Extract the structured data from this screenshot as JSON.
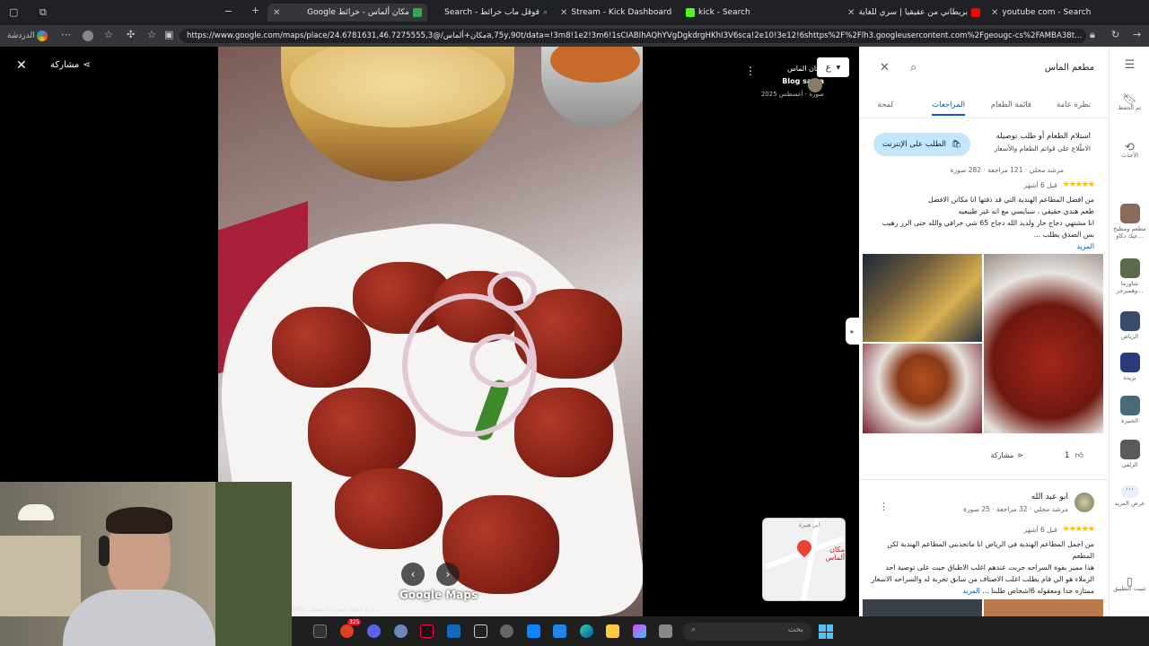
{
  "browser": {
    "tabs": [
      {
        "label": "مكان ألماس - خرائط Google",
        "active": true
      },
      {
        "label": "قوقل ماب خرائط - Search",
        "active": false
      },
      {
        "label": "Stream - Kick Dashboard",
        "active": false
      },
      {
        "label": "kick - Search",
        "active": false
      },
      {
        "label": "بريطاني من عقيقيا | سري للغاية",
        "active": false
      },
      {
        "label": "youtube com - Search",
        "active": false
      }
    ],
    "profile_label": "الدردشة",
    "url": "https://www.google.com/maps/place/مكان+ألماس/@24.6781631,46.7275555,3a,75y,90t/data=!3m8!1e2!3m6!1sCIABIhAQhYVgDgkdrgHKhI3V6sca!2e10!3e12!6shttps%2F%2Flh3.googleusercontent.com%2Fgeougc-cs%2FAMBA38t..."
  },
  "viewer": {
    "share_label": "مشاركة",
    "place_name": "مكان الماس",
    "author": "Blog sama",
    "date": "صورة - أغسطس 2025",
    "watermark": "Google Maps",
    "photo_date_caption": "تاريخ التقاط الصورة: أغسطس 2025",
    "map_label": "مكان ألماس",
    "map_street": "أبي هبيرة",
    "badge": "ع"
  },
  "panel": {
    "search_value": "مطعم الماس",
    "tabs": [
      {
        "label": "نظرة عامة",
        "selected": false
      },
      {
        "label": "قائمة الطعام",
        "selected": false
      },
      {
        "label": "المراجعات",
        "selected": true
      },
      {
        "label": "لمحة",
        "selected": false
      }
    ],
    "order_title": "استلام الطعام أو طلب توصيله",
    "order_sub": "الاطّلاع على قوائم الطعام والأسعار",
    "order_button": "الطلب على الإنترنت",
    "review1": {
      "meta": "مرشد محلي · 121 مراجعة · 282 صورة",
      "stars": "★★★★★",
      "time": "قبل 6 أشهر",
      "lines": [
        "من افضل المطاعم الهندية التي قد ذقتها انا مكانن الافضل",
        "طعم هندي حقيقي ، سبايسي مع انه غير طبيعيه",
        "انا مشتهي دجاج حار ولذيذ الله دجاج 65 شي خرافي والله حتى الرز رهيب بس الصدق يطلب ..."
      ],
      "more": "المزيد",
      "likes": "1",
      "share": "مشاركة"
    },
    "review2": {
      "name": "ابو عبد الله",
      "meta": "مرشد محلي · 32 مراجعة · 25 صورة",
      "stars": "★★★★★",
      "time": "قبل 6 أشهر",
      "lines": [
        "من اجمل المطاعم الهندية في الرياض انا ماتجذبني المطاعم الهندية لكن المطعم",
        "هذا مميز بقوة السراحه جربت عندهم اغلب الاطباق جيت على توصية احد",
        "الزملاء هو الي قام يطلب اغلب الاصناف من سابق تجربة له والسراحه الاسعار",
        "ممتازه جدا ومعقوله 6اشخاص طلبنا ..."
      ],
      "more": "المزيد"
    }
  },
  "rail": {
    "items": [
      {
        "label": "تم الحفظ"
      },
      {
        "label": "الأحدث"
      },
      {
        "label": "مطعم ومطبخ عيك دكاو..."
      },
      {
        "label": "شاورما وهمبرجر..."
      },
      {
        "label": "الرياض"
      },
      {
        "label": "بريدة"
      },
      {
        "label": "الخبيرة"
      },
      {
        "label": "الزلفي"
      },
      {
        "label": "عرض المزيد"
      },
      {
        "label": "تثبيت التطبيق"
      }
    ]
  },
  "taskbar": {
    "search_placeholder": "بحث",
    "badge": "325"
  }
}
